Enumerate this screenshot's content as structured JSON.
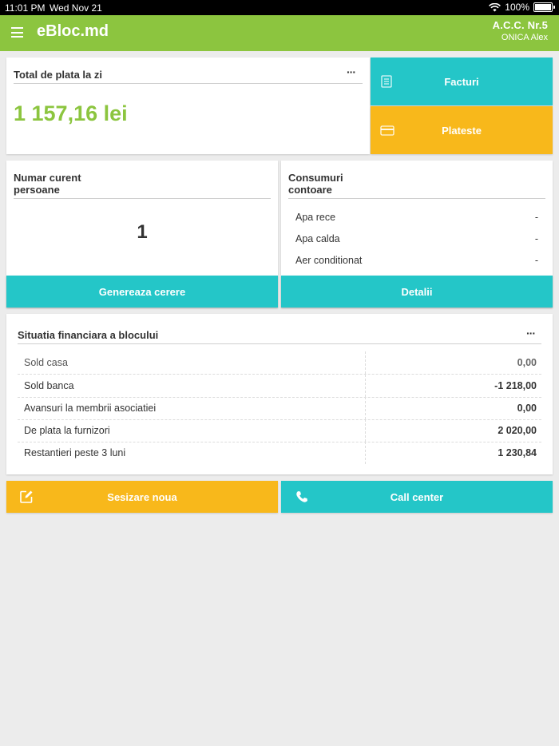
{
  "status_bar": {
    "time": "11:01 PM",
    "date": "Wed Nov 21",
    "battery": "100%"
  },
  "header": {
    "app_title": "eBloc.md",
    "association": "A.C.C. Nr.5",
    "user": "ONICA Alex"
  },
  "total": {
    "title": "Total de plata la zi",
    "amount": "1 157,16 lei",
    "menu": "···"
  },
  "actions": {
    "invoices_label": "Facturi",
    "pay_label": "Plateste"
  },
  "persons": {
    "title_line1": "Numar curent",
    "title_line2": "persoane",
    "count": "1",
    "button_label": "Genereaza cerere"
  },
  "meters": {
    "title_line1": "Consumuri",
    "title_line2": "contoare",
    "items": [
      {
        "label": "Apa rece",
        "value": "-"
      },
      {
        "label": "Apa calda",
        "value": "-"
      },
      {
        "label": "Aer conditionat",
        "value": "-"
      }
    ],
    "button_label": "Detalii"
  },
  "finance": {
    "title": "Situatia financiara a blocului",
    "menu": "···",
    "rows": [
      {
        "label": "Sold casa",
        "value": "0,00"
      },
      {
        "label": "Sold banca",
        "value": "-1 218,00"
      },
      {
        "label": "Avansuri la membrii asociatiei",
        "value": "0,00"
      },
      {
        "label": "De plata la furnizori",
        "value": "2 020,00"
      },
      {
        "label": "Restantieri peste 3 luni",
        "value": "1 230,84"
      }
    ]
  },
  "bottom": {
    "report_label": "Sesizare noua",
    "call_label": "Call center"
  },
  "colors": {
    "green": "#8cc53f",
    "teal": "#24c6c8",
    "yellow": "#f8b81b"
  }
}
